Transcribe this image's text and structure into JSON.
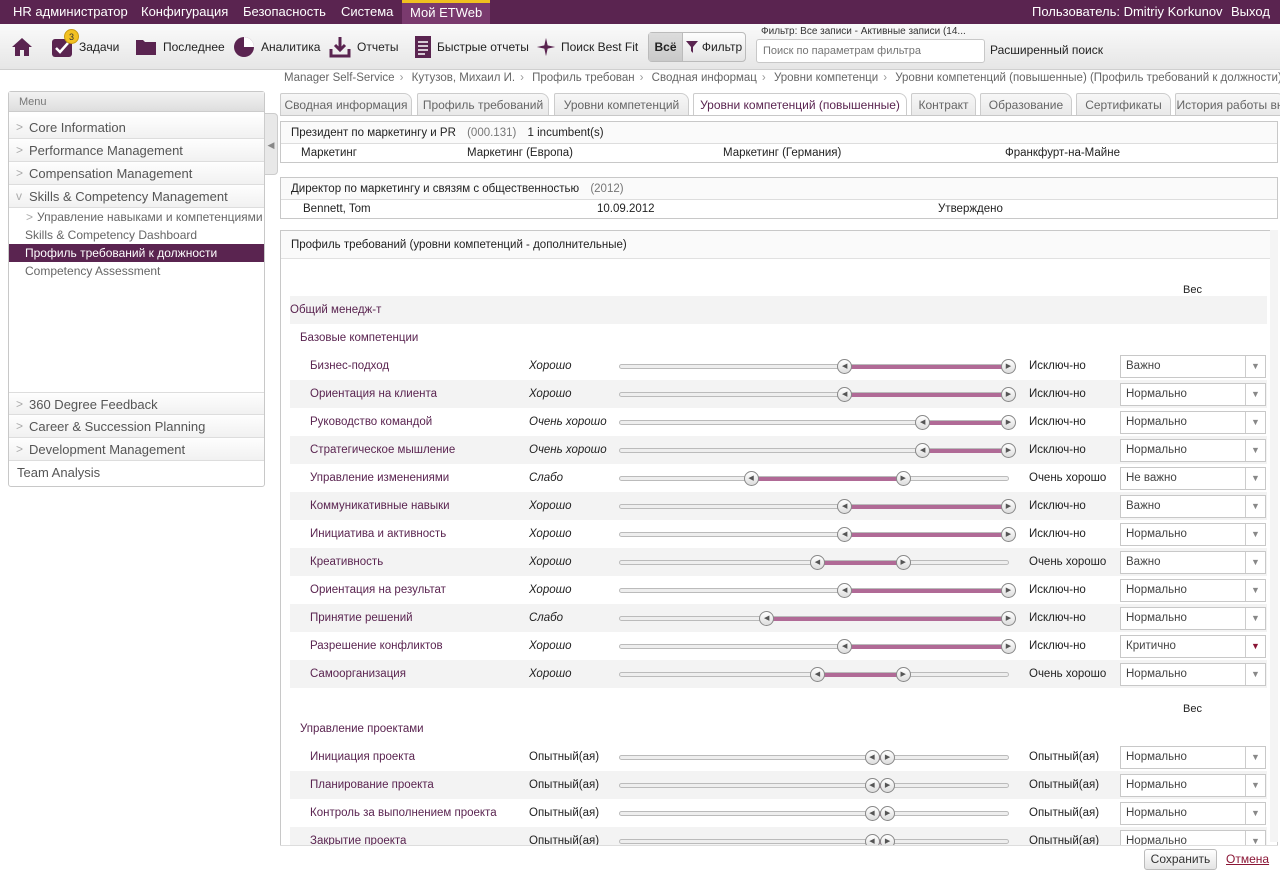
{
  "topnav": {
    "items": [
      "HR администратор",
      "Конфигурация",
      "Безопасность",
      "Система",
      "Мой ETWeb"
    ],
    "user": "Пользователь: Dmitriy Korkunov",
    "logout": "Выход"
  },
  "toolbar": {
    "tasks_badge": "3",
    "tasks": "Задачи",
    "recent": "Последнее",
    "analytics": "Аналитика",
    "reports": "Отчеты",
    "quick_reports": "Быстрые отчеты",
    "search_best_fit": "Поиск Best Fit",
    "all": "Всё",
    "filter": "Фильтр",
    "filter_label": "Фильтр: Все записи - Активные записи (14...",
    "filter_placeholder": "Поиск по параметрам фильтра",
    "advanced_search": "Расширенный поиск"
  },
  "breadcrumb": [
    "Manager Self-Service",
    "Кутузов, Михаил И.",
    "Профиль требован",
    "Сводная информац",
    "Уровни компетенци",
    "Уровни компетенций (повышенные) (Профиль требований к должности)"
  ],
  "menu": {
    "title": "Menu",
    "top_items": [
      "Core Information",
      "Performance Management",
      "Compensation Management",
      "Skills & Competency Management"
    ],
    "sub_group": "Управление навыками и компетенциями",
    "sub_items": [
      "Skills & Competency Dashboard",
      "Профиль требований к должности",
      "Competency Assessment"
    ],
    "bottom_items": [
      "360 Degree Feedback",
      "Career & Succession Planning",
      "Development Management",
      "Team Analysis"
    ]
  },
  "tabs": [
    "Сводная информация",
    "Профиль требований",
    "Уровни компетенций",
    "Уровни компетенций (повышенные)",
    "Контракт",
    "Образование",
    "Сертификаты",
    "История работы вн"
  ],
  "position": {
    "title": "Президент по маркетингу и PR",
    "code": "(000.131)",
    "incumbents": "1  incumbent(s)",
    "cols": [
      "Маркетинг",
      "Маркетинг (Европа)",
      "Маркетинг (Германия)",
      "Франкфурт-на-Майне"
    ]
  },
  "manager": {
    "title": "Директор по маркетингу и связям с общественностью",
    "year": "(2012)",
    "name": "Bennett, Tom",
    "date": "10.09.2012",
    "status": "Утверждено"
  },
  "profile": {
    "title": "Профиль требований (уровни компетенций - дополнительные)",
    "weight_header": "Вес",
    "group": "Общий менедж-т",
    "subgroup1": "Базовые компетенции",
    "subgroup2": "Управление проектами",
    "weight_header2": "Вес"
  },
  "competencies": [
    {
      "name": "Бизнес-подход",
      "min": "Хорошо",
      "max": "Исключ-но",
      "weight": "Важно",
      "from": 0.58,
      "to": 1.0
    },
    {
      "name": "Ориентация на клиента",
      "min": "Хорошо",
      "max": "Исключ-но",
      "weight": "Нормально",
      "from": 0.58,
      "to": 1.0
    },
    {
      "name": "Руководство командой",
      "min": "Очень хорошо",
      "max": "Исключ-но",
      "weight": "Нормально",
      "from": 0.78,
      "to": 1.0
    },
    {
      "name": "Стратегическое мышление",
      "min": "Очень хорошо",
      "max": "Исключ-но",
      "weight": "Нормально",
      "from": 0.78,
      "to": 1.0
    },
    {
      "name": "Управление изменениями",
      "min": "Слабо",
      "max": "Очень хорошо",
      "weight": "Не важно",
      "from": 0.34,
      "to": 0.73
    },
    {
      "name": "Коммуникативные навыки",
      "min": "Хорошо",
      "max": "Исключ-но",
      "weight": "Важно",
      "from": 0.58,
      "to": 1.0
    },
    {
      "name": "Инициатива и активность",
      "min": "Хорошо",
      "max": "Исключ-но",
      "weight": "Нормально",
      "from": 0.58,
      "to": 1.0
    },
    {
      "name": "Креативность",
      "min": "Хорошо",
      "max": "Очень хорошо",
      "weight": "Важно",
      "from": 0.51,
      "to": 0.73
    },
    {
      "name": "Ориентация на результат",
      "min": "Хорошо",
      "max": "Исключ-но",
      "weight": "Нормально",
      "from": 0.58,
      "to": 1.0
    },
    {
      "name": "Принятие решений",
      "min": "Слабо",
      "max": "Исключ-но",
      "weight": "Нормально",
      "from": 0.38,
      "to": 1.0
    },
    {
      "name": "Разрешение конфликтов",
      "min": "Хорошо",
      "max": "Исключ-но",
      "weight": "Критично",
      "from": 0.58,
      "to": 1.0
    },
    {
      "name": "Самоорганизация",
      "min": "Хорошо",
      "max": "Очень хорошо",
      "weight": "Нормально",
      "from": 0.51,
      "to": 0.73
    }
  ],
  "projects": [
    {
      "name": "Инициация проекта",
      "min": "Опытный(ая)",
      "max": "Опытный(ая)",
      "weight": "Нормально",
      "from": 0.65,
      "to": 0.69
    },
    {
      "name": "Планирование проекта",
      "min": "Опытный(ая)",
      "max": "Опытный(ая)",
      "weight": "Нормально",
      "from": 0.65,
      "to": 0.69
    },
    {
      "name": "Контроль за выполнением проекта",
      "min": "Опытный(ая)",
      "max": "Опытный(ая)",
      "weight": "Нормально",
      "from": 0.65,
      "to": 0.69
    },
    {
      "name": "Закрытие проекта",
      "min": "Опытный(ая)",
      "max": "Опытный(ая)",
      "weight": "Нормально",
      "from": 0.65,
      "to": 0.69
    }
  ],
  "footer": {
    "save": "Сохранить",
    "cancel": "Отмена"
  }
}
